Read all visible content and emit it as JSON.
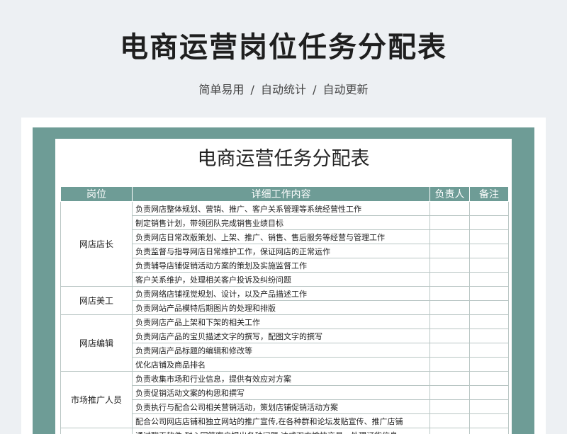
{
  "header": {
    "title": "电商运营岗位任务分配表",
    "subtitle": "简单易用 / 自动统计 / 自动更新"
  },
  "sheet": {
    "title": "电商运营任务分配表",
    "columns": [
      "岗位",
      "详细工作内容",
      "负责人",
      "备注"
    ],
    "groups": [
      {
        "role": "网店店长",
        "tasks": [
          "负责网店整体规划、营销、推广、客户关系管理等系统经营性工作",
          "制定销售计划，带领团队完成销售业绩目标",
          "负责网店日常改版策划、上架、推广、销售、售后服务等经营与管理工作",
          "负责监督与指导网店日常维护工作，保证网店的正常运作",
          "负责辅导店铺促销活动方案的策划及实施监督工作",
          "客户关系维护，处理相关客户投诉及纠纷问题"
        ]
      },
      {
        "role": "网店美工",
        "tasks": [
          "负责网络店铺视觉规划、设计，以及产品描述工作",
          "负责网站产品模特后期图片的处理和排版"
        ]
      },
      {
        "role": "网店编辑",
        "tasks": [
          "负责网店产品上架和下架的相关工作",
          "负责网店产品的宝贝描述文字的撰写，配图文字的撰写",
          "负责网店产品标题的编辑和修改等",
          "优化店铺及商品排名"
        ]
      },
      {
        "role": "市场推广人员",
        "tasks": [
          "负责收集市场和行业信息，提供有效应对方案",
          "负责促销活动文案的构思和撰写",
          "负责执行与配合公司相关营销活动，策划店铺促销活动方案",
          "配合公司网店店铺和独立网站的推广宣传,在各种群和论坛发贴宣传、推广店铺"
        ]
      },
      {
        "role": "",
        "tasks": [
          "通过聊天软件,耐心回答客户提出各种问题,达成双方愉快交易，处理订货信息"
        ]
      }
    ]
  }
}
